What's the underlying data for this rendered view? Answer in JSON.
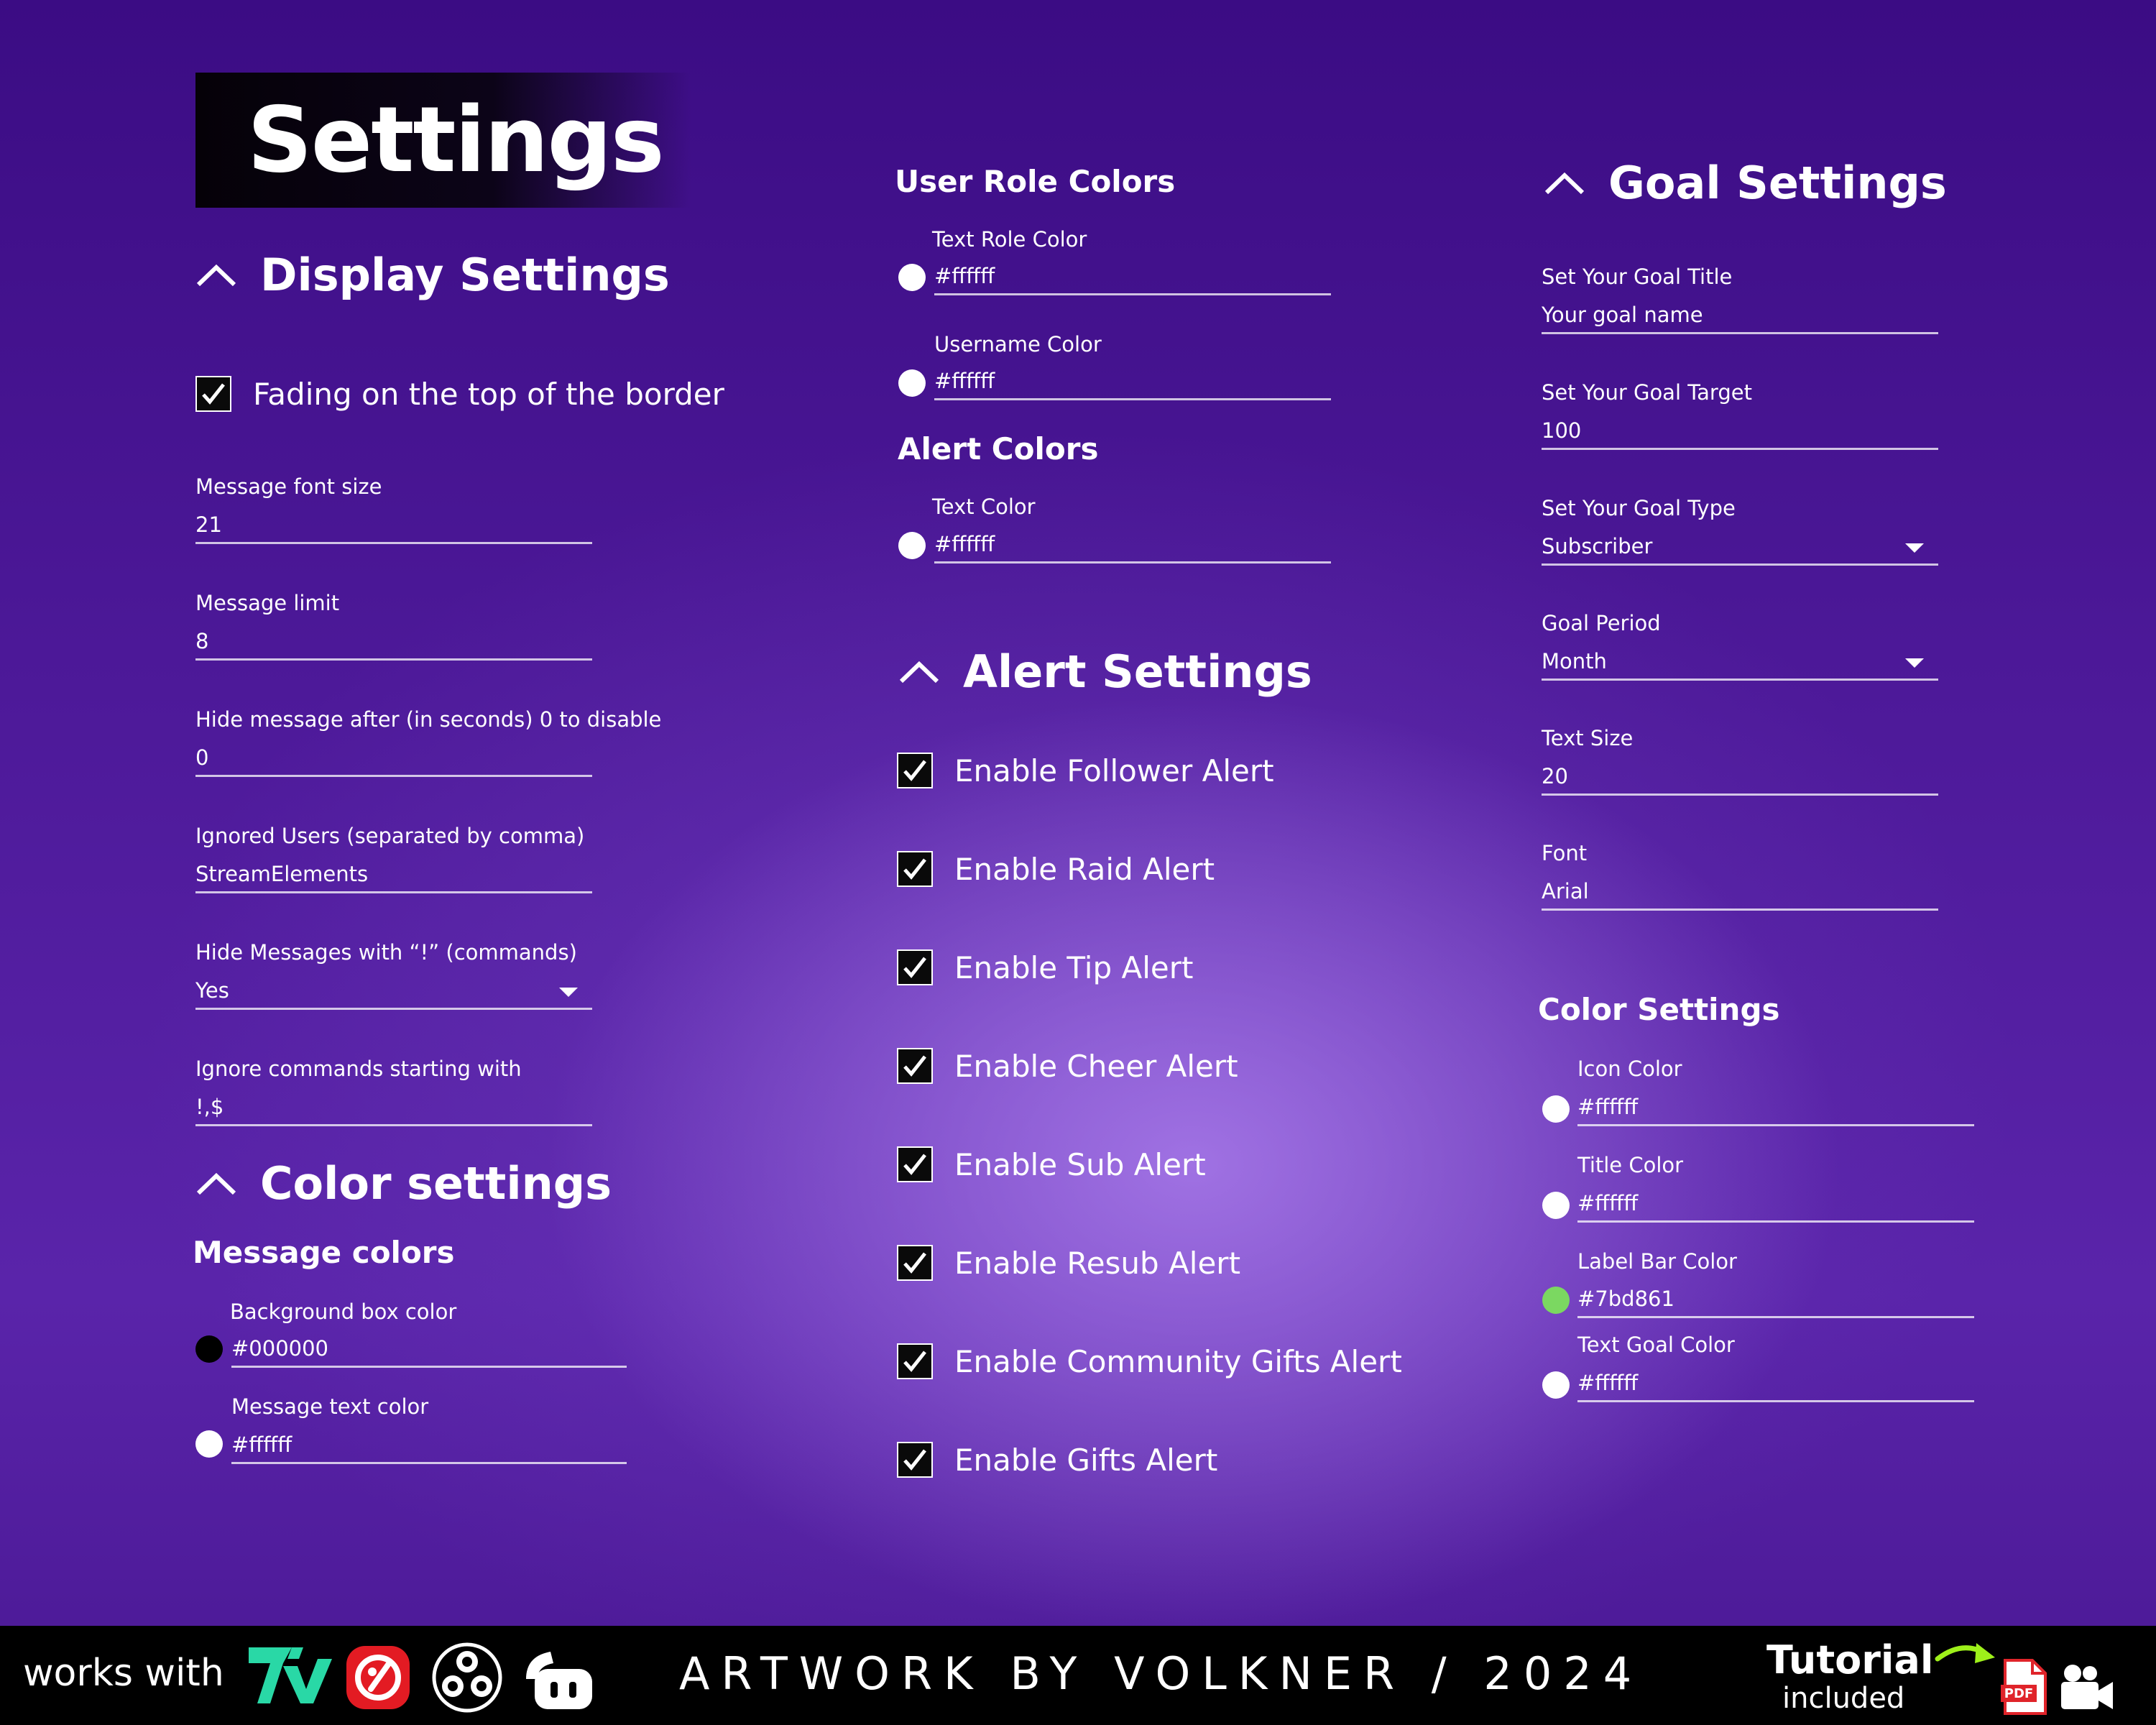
{
  "page_title": "Settings",
  "display_settings": {
    "heading": "Display Settings",
    "fading_label": "Fading on the top of the border",
    "fading_checked": true,
    "font_size": {
      "label": "Message font size",
      "value": "21"
    },
    "limit": {
      "label": "Message limit",
      "value": "8"
    },
    "hide_after": {
      "label": "Hide message after (in seconds) 0 to disable",
      "value": "0"
    },
    "ignored": {
      "label": "Ignored Users (separated by comma)",
      "value": "StreamElements"
    },
    "hide_cmd": {
      "label": "Hide Messages with “!” (commands)",
      "value": "Yes"
    },
    "ignore_prefix": {
      "label": "Ignore commands starting with",
      "value": "!,$"
    }
  },
  "color_settings_left": {
    "heading": "Color settings",
    "subheading": "Message colors",
    "bg": {
      "label": "Background box color",
      "value": "#000000",
      "swatch": "#000000"
    },
    "text": {
      "label": "Message text color",
      "value": "#ffffff",
      "swatch": "#ffffff"
    }
  },
  "user_role_colors": {
    "heading": "User Role Colors",
    "role": {
      "label": "Text Role Color",
      "value": "#ffffff",
      "swatch": "#ffffff"
    },
    "username": {
      "label": "Username Color",
      "value": "#ffffff",
      "swatch": "#ffffff"
    }
  },
  "alert_colors": {
    "heading": "Alert Colors",
    "text": {
      "label": "Text  Color",
      "value": "#ffffff",
      "swatch": "#ffffff"
    }
  },
  "alert_settings": {
    "heading": "Alert Settings",
    "items": [
      {
        "label": "Enable Follower Alert",
        "checked": true
      },
      {
        "label": "Enable Raid Alert",
        "checked": true
      },
      {
        "label": "Enable Tip Alert",
        "checked": true
      },
      {
        "label": "Enable Cheer Alert",
        "checked": true
      },
      {
        "label": "Enable Sub Alert",
        "checked": true
      },
      {
        "label": "Enable Resub Alert",
        "checked": true
      },
      {
        "label": "Enable Community Gifts Alert",
        "checked": true
      },
      {
        "label": "Enable Gifts Alert",
        "checked": true
      }
    ]
  },
  "goal_settings": {
    "heading": "Goal Settings",
    "title": {
      "label": "Set Your Goal Title",
      "value": "Your goal name"
    },
    "target": {
      "label": "Set Your Goal Target",
      "value": "100"
    },
    "type": {
      "label": "Set Your Goal Type",
      "value": "Subscriber"
    },
    "period": {
      "label": "Goal Period",
      "value": "Month"
    },
    "text_size": {
      "label": "Text Size",
      "value": "20"
    },
    "font": {
      "label": "Font",
      "value": "Arial"
    }
  },
  "color_settings_right": {
    "heading": "Color Settings",
    "icon": {
      "label": "Icon Color",
      "value": "#ffffff",
      "swatch": "#ffffff"
    },
    "title": {
      "label": "Title Color",
      "value": "#ffffff",
      "swatch": "#ffffff"
    },
    "label_bar": {
      "label": "Label Bar Color",
      "value": "#7bd861",
      "swatch": "#7bd861"
    },
    "text_goal": {
      "label": "Text Goal Color",
      "value": "#ffffff",
      "swatch": "#ffffff"
    }
  },
  "footer": {
    "works_with": "works with",
    "artwork": "ARTWORK BY VOLKNER / 2024",
    "tutorial": "Tutorial",
    "included": "included",
    "pdf_text": "PDF",
    "platform_icons": [
      "7tv-logo",
      "streamlabs-logo",
      "obs-logo",
      "streamelements-logo"
    ]
  }
}
